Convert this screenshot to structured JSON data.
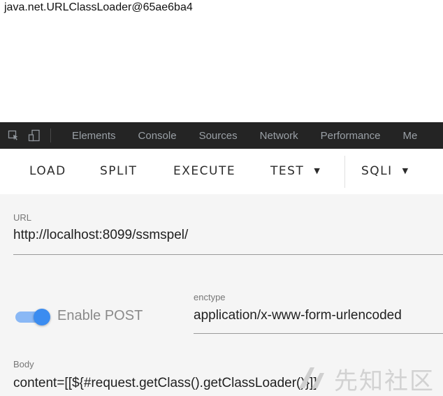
{
  "page_output": {
    "text": "java.net.URLClassLoader@65ae6ba4"
  },
  "devtools": {
    "tabs": [
      "Elements",
      "Console",
      "Sources",
      "Network",
      "Performance",
      "Me"
    ]
  },
  "toolbar": {
    "load": "LOAD",
    "split": "SPLIT",
    "execute": "EXECUTE",
    "test": "TEST",
    "sqli": "SQLI"
  },
  "form": {
    "url_label": "URL",
    "url_value": "http://localhost:8099/ssmspel/",
    "enable_post_label": "Enable POST",
    "enable_post_on": true,
    "enctype_label": "enctype",
    "enctype_value": "application/x-www-form-urlencoded",
    "body_label": "Body",
    "body_value": "content=[[${#request.getClass().getClassLoader()}]]"
  },
  "watermark": {
    "text": "先知社区"
  },
  "colors": {
    "devtools_bg": "#242424",
    "panel_bg": "#f5f5f5",
    "toggle_accent": "#3b8cf0"
  }
}
